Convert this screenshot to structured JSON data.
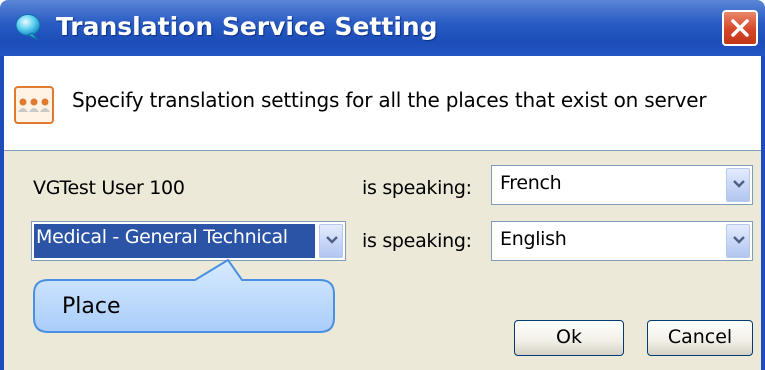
{
  "window": {
    "title": "Translation Service Setting",
    "title_icon": "chat-bubble-icon",
    "close_icon": "close-icon"
  },
  "header": {
    "icon": "people-group-icon",
    "description": "Specify translation settings for all the places that exist on server"
  },
  "rows": [
    {
      "participant": "VGTest User 100",
      "speaking_label": "is speaking:",
      "language": "French"
    },
    {
      "participant": "Medical - General Technical",
      "speaking_label": "is speaking:",
      "language": "English"
    }
  ],
  "callout": {
    "text": "Place"
  },
  "buttons": {
    "ok": "Ok",
    "cancel": "Cancel"
  },
  "colors": {
    "title_bar": "#2a5cc4",
    "close_button": "#d5462a",
    "selection": "#2b54a6",
    "body_background": "#ece9d8",
    "callout_fill": "#bcd9fb",
    "callout_border": "#4a90e2"
  }
}
